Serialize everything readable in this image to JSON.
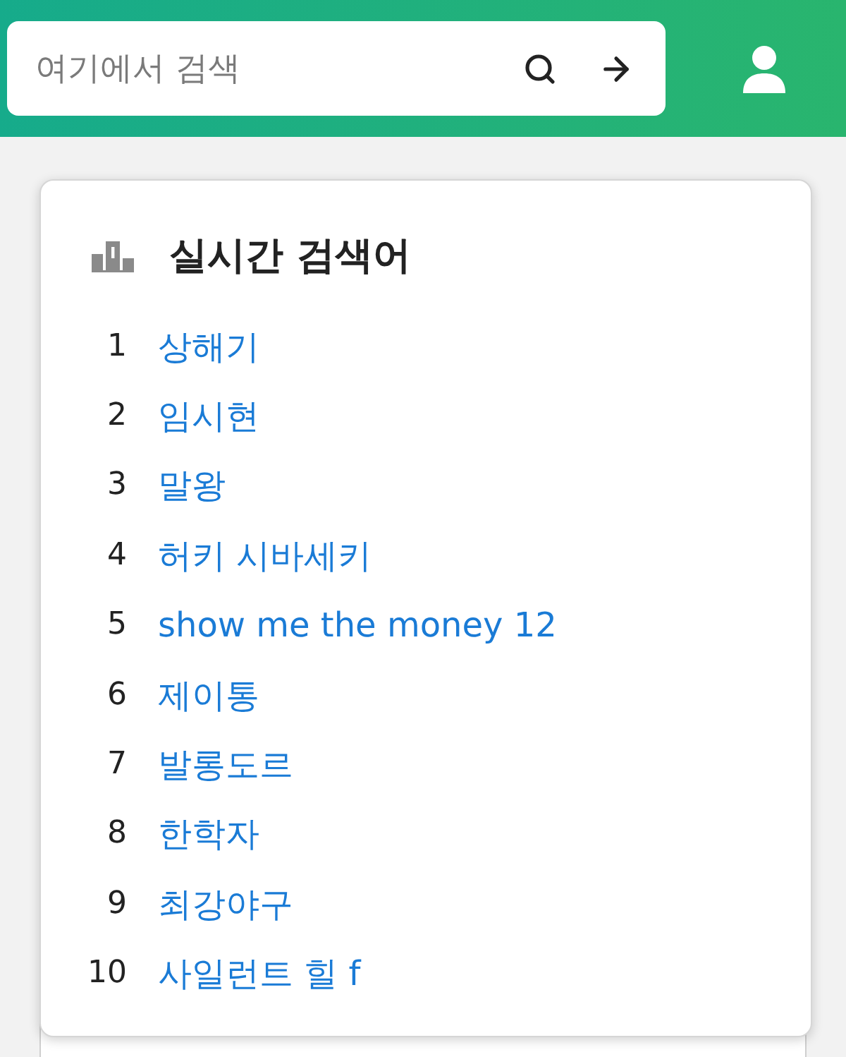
{
  "search": {
    "placeholder": "여기에서 검색"
  },
  "trending": {
    "title": "실시간 검색어",
    "items": [
      {
        "rank": "1",
        "text": "상해기"
      },
      {
        "rank": "2",
        "text": "임시현"
      },
      {
        "rank": "3",
        "text": "말왕"
      },
      {
        "rank": "4",
        "text": "허키 시바세키"
      },
      {
        "rank": "5",
        "text": "show me the money 12"
      },
      {
        "rank": "6",
        "text": "제이통"
      },
      {
        "rank": "7",
        "text": "발롱도르"
      },
      {
        "rank": "8",
        "text": "한학자"
      },
      {
        "rank": "9",
        "text": "최강야구"
      },
      {
        "rank": "10",
        "text": "사일런트 힐 f"
      }
    ]
  }
}
